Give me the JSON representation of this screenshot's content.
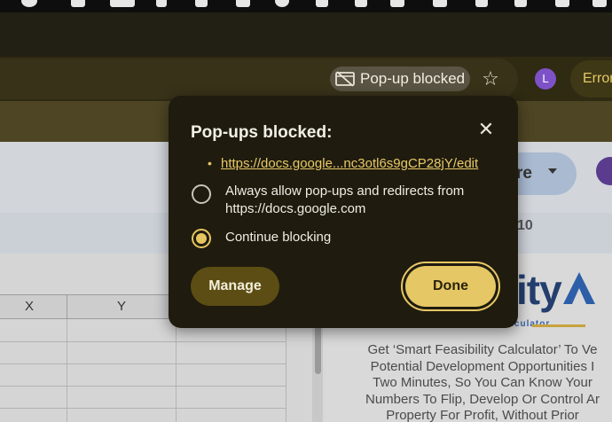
{
  "browser": {
    "popup_chip_label": "Pop-up blocked",
    "profile_initial": "L",
    "error_chip_label": "Error"
  },
  "sheet": {
    "share_label": "re",
    "toolbar_number": "10",
    "column_headers": [
      "X",
      "Y"
    ]
  },
  "doc": {
    "logo_text": "ity",
    "logo_subtext": "calculator",
    "body_lines": [
      "Get ‘Smart Feasibility Calculator’ To Ve",
      "Potential Development Opportunities I",
      "Two Minutes, So You Can Know Your",
      "Numbers To Flip, Develop Or Control Ar",
      "Property For Profit, Without Prior"
    ]
  },
  "popup": {
    "title": "Pop-ups blocked:",
    "blocked_url": "https://docs.google...nc3otl6s9gCP28jY/edit",
    "option_allow_line1": "Always allow pop-ups and redirects from",
    "option_allow_line2": "https://docs.google.com",
    "option_block": "Continue blocking",
    "selected_option": "Continue blocking",
    "manage_label": "Manage",
    "done_label": "Done"
  },
  "colors": {
    "bubble_bg": "#1f1b0f",
    "accent": "#e5c765",
    "link": "#e8ca66",
    "manage_bg": "#5c4d14"
  }
}
